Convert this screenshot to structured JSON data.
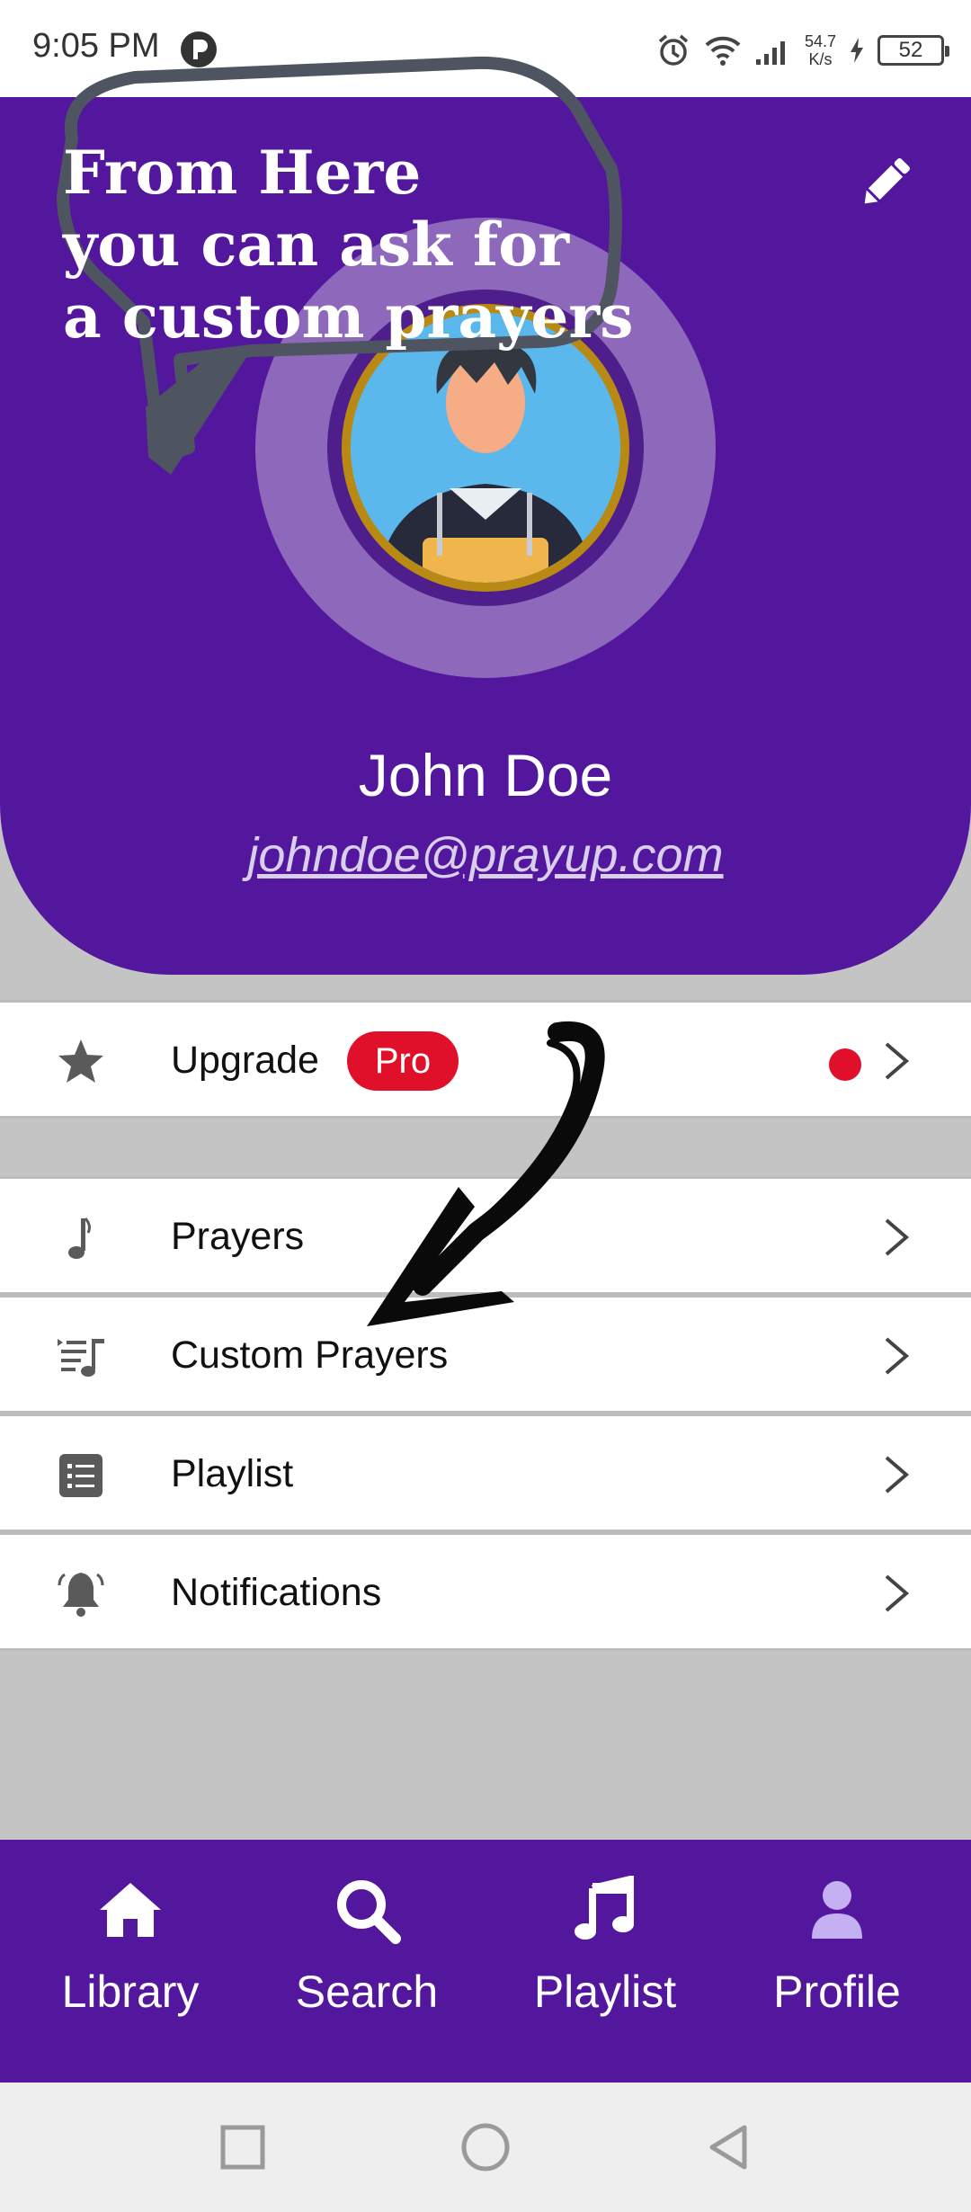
{
  "status_bar": {
    "time": "9:05 PM",
    "speed_value": "54.7",
    "speed_unit": "K/s",
    "battery": "52"
  },
  "profile": {
    "name": "John Doe",
    "email": "johndoe@prayup.com"
  },
  "annotation": {
    "callout_text": "From Here\nyou can ask for\na custom prayers"
  },
  "menu": {
    "upgrade": {
      "label": "Upgrade",
      "badge": "Pro",
      "icon": "star-icon"
    },
    "items": [
      {
        "label": "Prayers",
        "icon": "music-note-icon"
      },
      {
        "label": "Custom Prayers",
        "icon": "custom-playlist-icon"
      },
      {
        "label": "Playlist",
        "icon": "list-icon"
      },
      {
        "label": "Notifications",
        "icon": "bell-icon"
      }
    ]
  },
  "bottom_nav": [
    {
      "label": "Library",
      "icon": "home-icon"
    },
    {
      "label": "Search",
      "icon": "search-icon"
    },
    {
      "label": "Playlist",
      "icon": "music-icon"
    },
    {
      "label": "Profile",
      "icon": "user-icon"
    }
  ],
  "colors": {
    "primary": "#53179d",
    "accent_red": "#e0102a",
    "background": "#c4c4c4"
  }
}
